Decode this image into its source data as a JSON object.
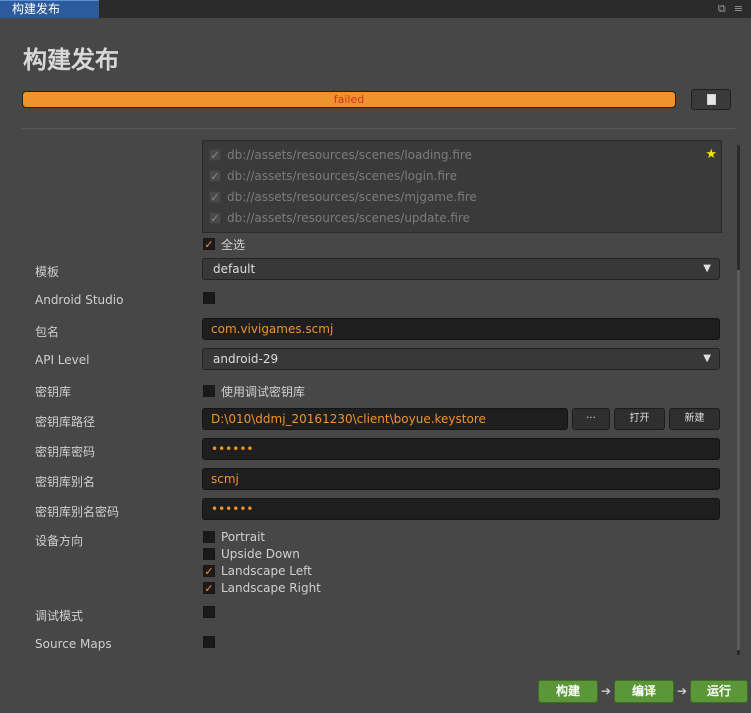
{
  "tab": {
    "label": "构建发布"
  },
  "page": {
    "title": "构建发布"
  },
  "progress": {
    "status": "failed",
    "value_percent": 100
  },
  "scenes": {
    "items": [
      {
        "path": "db://assets/resources/scenes/loading.fire",
        "checked": true
      },
      {
        "path": "db://assets/resources/scenes/login.fire",
        "checked": true
      },
      {
        "path": "db://assets/resources/scenes/mjgame.fire",
        "checked": true
      },
      {
        "path": "db://assets/resources/scenes/update.fire",
        "checked": true
      }
    ],
    "select_all_label": "全选"
  },
  "form": {
    "template": {
      "label": "模板",
      "value": "default"
    },
    "android_studio": {
      "label": "Android Studio"
    },
    "package_name": {
      "label": "包名",
      "value": "com.vivigames.scmj"
    },
    "api_level": {
      "label": "API Level",
      "value": "android-29"
    },
    "keystore": {
      "label": "密钥库",
      "debug_label": "使用调试密钥库"
    },
    "keystore_path": {
      "label": "密钥库路径",
      "value": "D:\\010\\ddmj_20161230\\client\\boyue.keystore",
      "browse_label": "···",
      "open_label": "打开",
      "new_label": "新建"
    },
    "keystore_password": {
      "label": "密钥库密码",
      "value": "••••••"
    },
    "keystore_alias": {
      "label": "密钥库别名",
      "value": "scmj"
    },
    "alias_password": {
      "label": "密钥库别名密码",
      "value": "••••••"
    },
    "orientation": {
      "label": "设备方向",
      "options": [
        {
          "label": "Portrait",
          "checked": false
        },
        {
          "label": "Upside Down",
          "checked": false
        },
        {
          "label": "Landscape Left",
          "checked": true
        },
        {
          "label": "Landscape Right",
          "checked": true
        }
      ]
    },
    "debug_mode": {
      "label": "调试模式"
    },
    "source_maps": {
      "label": "Source Maps"
    }
  },
  "actions": {
    "build": "构建",
    "compile": "编译",
    "run": "运行"
  },
  "colors": {
    "accent": "#f0922d",
    "error": "#d6322a",
    "action": "#5b9639",
    "tab": "#2d5a9a"
  }
}
